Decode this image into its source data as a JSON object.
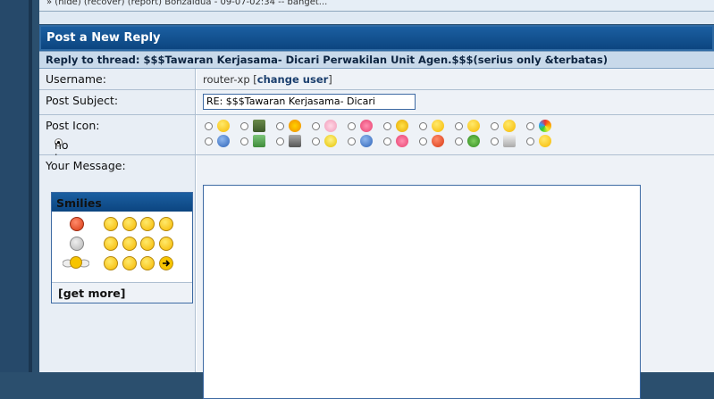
{
  "top_strip": {
    "text": "» (hide) (recover) (report) Bonzaidua - 09-07-02:34 -- banget..."
  },
  "panel": {
    "title": "Post a New Reply",
    "thread_line": "Reply to thread: $$$Tawaran Kerjasama- Dicari Perwakilan Unit Agen.$$$(serius only &terbatas)"
  },
  "username": {
    "label": "Username:",
    "value": "router-xp",
    "open_bracket": "[",
    "change_link": "change user",
    "close_bracket": "]"
  },
  "subject": {
    "label": "Post Subject:",
    "value": "RE: $$$Tawaran Kerjasama- Dicari Perwakilan Unit Agen.$$$(serius only &terbatas)"
  },
  "post_icon": {
    "label": "Post Icon:",
    "no_icon_label": "no icon",
    "row1": [
      "smile-icon",
      "film-icon",
      "sun-icon",
      "flower-icon",
      "heart-icon",
      "star-icon",
      "smile-icon",
      "grin-icon",
      "wink-icon",
      "rainbow-icon"
    ],
    "row2": [
      "question-icon",
      "image-icon",
      "music-icon",
      "lightbulb-icon",
      "info-icon",
      "heart-icon",
      "exclamation-icon",
      "bug-icon",
      "cube-icon",
      "smile-icon"
    ]
  },
  "message": {
    "label": "Your Message:"
  },
  "smilies": {
    "title": "Smilies",
    "get_more": "[get more]",
    "accent": "#0c4580"
  }
}
